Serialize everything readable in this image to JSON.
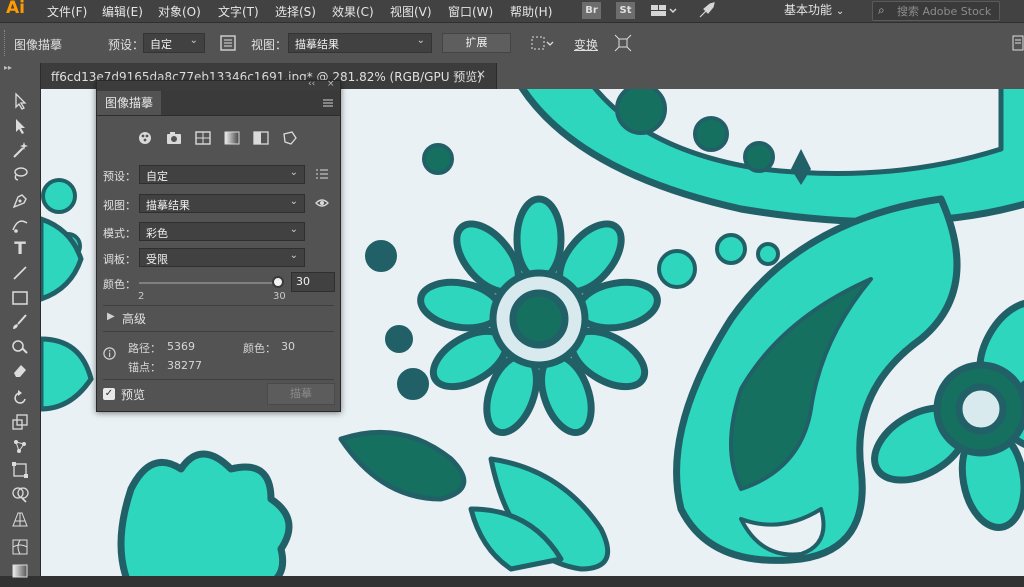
{
  "app": {
    "logo": "Ai"
  },
  "menu": {
    "items": [
      "文件(F)",
      "编辑(E)",
      "对象(O)",
      "文字(T)",
      "选择(S)",
      "效果(C)",
      "视图(V)",
      "窗口(W)",
      "帮助(H)"
    ],
    "br": "Br",
    "st": "St",
    "workspace": "基本功能",
    "stock_search_placeholder": "搜索 Adobe Stock"
  },
  "controlbar": {
    "panel_title": "图像描摹",
    "preset_label": "预设：",
    "preset_value": "自定",
    "view_label": "视图：",
    "view_value": "描摹结果",
    "expand_button": "扩展",
    "transform_button": "变换"
  },
  "document": {
    "tab_title": "ff6cd13e7d9165da8c77eb13346c1691.jpg* @ 281.82% (RGB/GPU 预览)",
    "close": "×"
  },
  "trace_panel": {
    "collapse": "‹‹",
    "close": "×",
    "tab": "图像描摹",
    "preset_label": "预设：",
    "preset_value": "自定",
    "view_label": "视图：",
    "view_value": "描摹结果",
    "mode_label": "模式：",
    "mode_value": "彩色",
    "palette_label": "调板：",
    "palette_value": "受限",
    "colors_label": "颜色：",
    "colors_value": "30",
    "colors_fraction": 0.98,
    "colors_min": "2",
    "colors_max": "30",
    "advanced": "高级",
    "paths_label": "路径：",
    "paths_value": "5369",
    "colors_stat_label": "颜色：",
    "colors_stat_value": "30",
    "anchors_label": "锚点：",
    "anchors_value": "38277",
    "preview_label": "预览",
    "preview_checked": true,
    "trace_button": "描摹"
  },
  "colors": {
    "teal": "#2ed6bd",
    "dark_teal": "#226068",
    "deep_green": "#157060",
    "pale": "#d9eaef"
  }
}
